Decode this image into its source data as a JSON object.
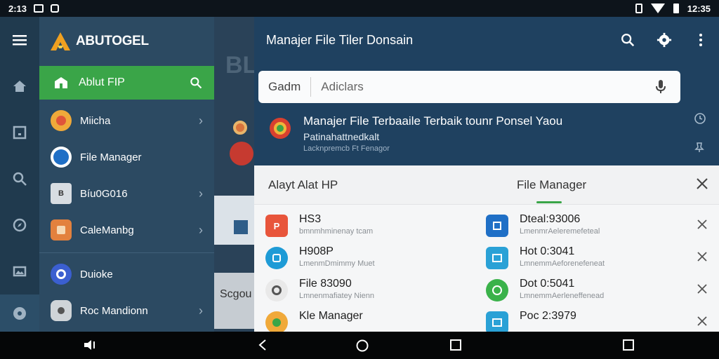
{
  "status_bar": {
    "time_left": "2:13",
    "time_right": "12:35"
  },
  "drawer": {
    "brand": "ABUTOGEL",
    "active": {
      "label": "Ablut FIP"
    },
    "items": [
      {
        "label": "Miicha",
        "chevron": true
      },
      {
        "label": "File Manager",
        "chevron": false
      },
      {
        "label": "Bíu0G016",
        "chevron": true
      },
      {
        "label": "CaleManbg",
        "chevron": true
      },
      {
        "label": "Duioke",
        "chevron": false
      },
      {
        "label": "Roc Mandionn",
        "chevron": true
      }
    ]
  },
  "background": {
    "letters": "BL",
    "card_text": "Scgou"
  },
  "app_bar": {
    "title": "Manajer File Tiler Donsain"
  },
  "search": {
    "scope": "Gadm",
    "placeholder": "Adiclars"
  },
  "result": {
    "title": "Manajer File Terbaaile Terbaik tounr Ponsel Yaou",
    "subtitle": "Patinahattnedkalt",
    "meta": "Lacknpremcb Ft Fenagor"
  },
  "sheet": {
    "tab_left": "Alayt Alat HP",
    "tab_right": "File Manager",
    "items_left": [
      {
        "title": "HS3",
        "sub": "bmnmhminenay tcam",
        "color": "#e8553b"
      },
      {
        "title": "H908P",
        "sub": "LmenmDmimmy Muet",
        "color": "#1e9bd6"
      },
      {
        "title": "File 83090",
        "sub": "Lmnenmafiatey Nienn",
        "color": "#eeeeee"
      },
      {
        "title": "Kle Manager",
        "sub": "",
        "color": "#f0a93a"
      }
    ],
    "items_right": [
      {
        "title": "Dteal:93006",
        "sub": "LmenmrAeleremefeteal",
        "color": "#1f6fc6"
      },
      {
        "title": "Hot 0:3041",
        "sub": "LmnemmAeforenefeneat",
        "color": "#2aa1d6"
      },
      {
        "title": "Dot 0:5041",
        "sub": "LmnemmAerleneffenead",
        "color": "#3ab24a"
      },
      {
        "title": "Poc 2:3979",
        "sub": "",
        "color": "#2aa1d6"
      }
    ]
  }
}
